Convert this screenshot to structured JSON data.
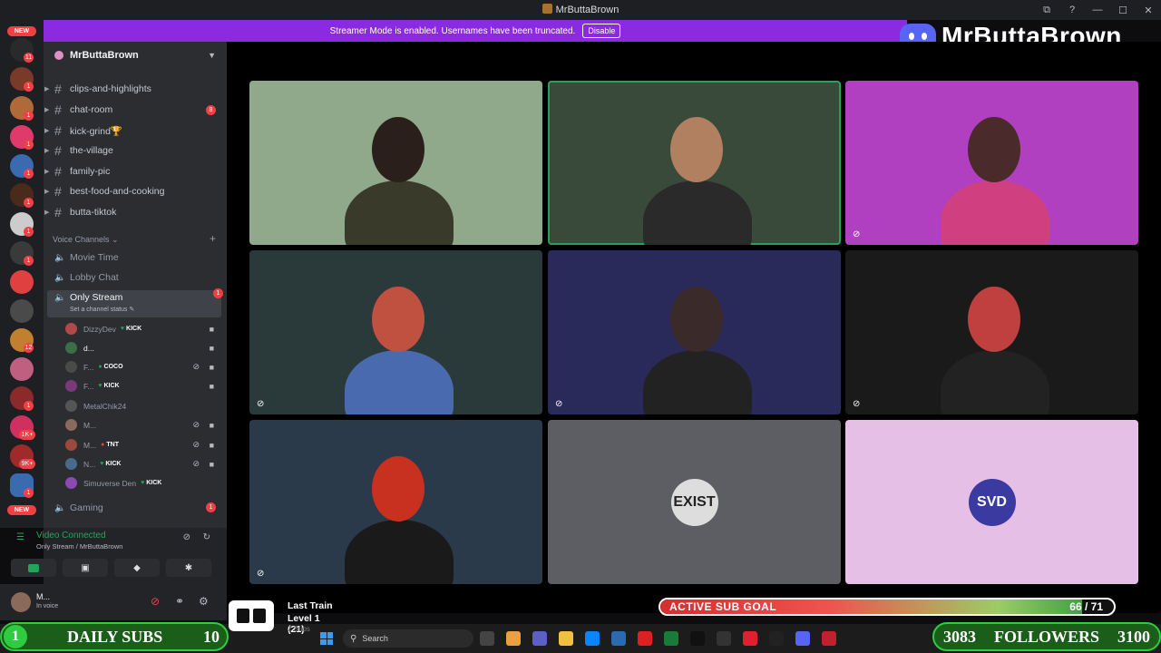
{
  "window": {
    "title": "MrButtaBrown",
    "controls": [
      "⧉",
      "?",
      "—",
      "☐",
      "✕"
    ]
  },
  "banner": {
    "text": "Streamer Mode is enabled. Usernames have been truncated.",
    "button": "Disable"
  },
  "brand": {
    "name": "MrButtaBrown"
  },
  "server_rail": {
    "new_top": "NEW",
    "new_bottom": "NEW",
    "badges": [
      "11",
      "1",
      "1",
      "1",
      "1",
      "1",
      "1",
      "1",
      "12",
      "1",
      "1",
      "1K+",
      "9K+",
      "1"
    ]
  },
  "server": {
    "name": "MrButtaBrown"
  },
  "text_channels": [
    {
      "name": "clips-and-highlights",
      "badge": ""
    },
    {
      "name": "chat-room",
      "badge": "8"
    },
    {
      "name": "kick-grind🏆",
      "badge": ""
    },
    {
      "name": "the-village",
      "badge": ""
    },
    {
      "name": "family-pic",
      "badge": ""
    },
    {
      "name": "best-food-and-cooking",
      "badge": ""
    },
    {
      "name": "butta-tiktok",
      "badge": ""
    }
  ],
  "voice_header": "Voice Channels",
  "voice_channels": {
    "movie_time": "Movie Time",
    "lobby_chat": "Lobby Chat",
    "only_stream": "Only Stream",
    "only_stream_badge": "1",
    "only_stream_status": "Set a channel status ✎",
    "gaming": "Gaming",
    "gaming_badge": "1"
  },
  "voice_users": [
    {
      "name": "DizzyDev",
      "tag": "KICK",
      "avatar": "#b04a4a"
    },
    {
      "name": "d...",
      "tag": "",
      "avatar": "#3c6e4a"
    },
    {
      "name": "F...",
      "tag": "COCO",
      "avatar": "#4a4a4a"
    },
    {
      "name": "F...",
      "tag": "KICK",
      "avatar": "#7a3a7a"
    },
    {
      "name": "MetalChik24",
      "tag": "",
      "avatar": "#555"
    },
    {
      "name": "M...",
      "tag": "",
      "avatar": "#8a6a5a"
    },
    {
      "name": "M...",
      "tag": "TNT",
      "avatar": "#9a4a3a"
    },
    {
      "name": "N...",
      "tag": "KICK",
      "avatar": "#4a6a8a"
    },
    {
      "name": "Simuverse Den",
      "tag": "KICK",
      "avatar": "#8a4ab0"
    }
  ],
  "voice_connection": {
    "status": "Video Connected",
    "location": "Only Stream / MrButtaBrown"
  },
  "current_user": {
    "name": "M...",
    "status": "In voice"
  },
  "tiles": [
    {
      "type": "video",
      "bg": "#8fa98a",
      "person": "#2a1f1a",
      "shirt": "#3a3a2a"
    },
    {
      "type": "video",
      "bg": "#3a4a3a",
      "person": "#b08060",
      "shirt": "#2a2a2a"
    },
    {
      "type": "video",
      "bg": "#b040c0",
      "person": "#4a2a2a",
      "shirt": "#d04080"
    },
    {
      "type": "video",
      "bg": "#2a3a3a",
      "person": "#c05040",
      "shirt": "#4a6ab0"
    },
    {
      "type": "video",
      "bg": "#2a2a5a",
      "person": "#3a2a2a",
      "shirt": "#222"
    },
    {
      "type": "video",
      "bg": "#1a1a1a",
      "person": "#c04040",
      "shirt": "#222"
    },
    {
      "type": "video",
      "bg": "#2a3a4a",
      "person": "#c83020",
      "shirt": "#1a1a1a"
    },
    {
      "type": "avatar",
      "bg": "#5c5e63",
      "logo": "EXIST",
      "logo_bg": "#ddd",
      "logo_color": "#222"
    },
    {
      "type": "avatar",
      "bg": "#e6bfe6",
      "logo": "SVD",
      "logo_bg": "#3a3aa0",
      "logo_color": "#fff"
    }
  ],
  "overlay": {
    "daily_subs": {
      "count": "1",
      "label": "DAILY SUBS",
      "goal": "10"
    },
    "followers": {
      "count": "3083",
      "label": "FOLLOWERS",
      "goal": "3100"
    },
    "sub_goal": {
      "label": "ACTIVE SUB GOAL",
      "current": 66,
      "target": 71,
      "text": "66 / 71"
    },
    "music": {
      "title": "Last Train",
      "level": "Level 1  (21)",
      "small": "2 Subs"
    }
  },
  "taskbar": {
    "search_placeholder": "Search",
    "icon_colors": [
      "#444",
      "#e8a040",
      "#5b5fc7",
      "#f0c040",
      "#0a84ff",
      "#2a6ab0",
      "#e02020",
      "#1a7a3a",
      "#111",
      "#333",
      "#e02030",
      "#222",
      "#5865f2",
      "#c02030"
    ]
  }
}
